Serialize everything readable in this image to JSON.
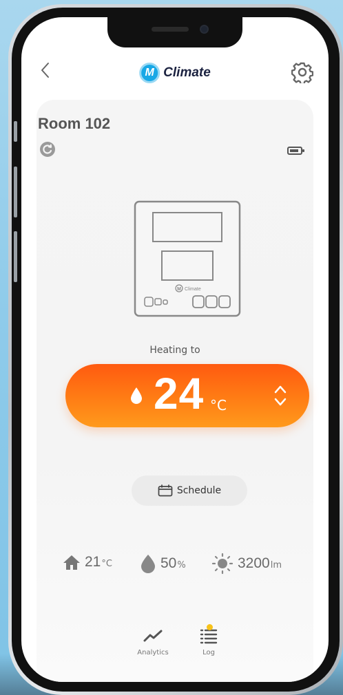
{
  "app": {
    "logo_letter": "M",
    "name": "Climate"
  },
  "room": {
    "title": "Room 102"
  },
  "device_label": "Climate",
  "heating": {
    "label": "Heating to",
    "value": "24",
    "unit": "°C",
    "gradient_colors": [
      "#ff5a10",
      "#ff9a1c"
    ]
  },
  "schedule": {
    "label": "Schedule"
  },
  "stats": [
    {
      "icon": "home-icon",
      "value": "21",
      "unit": "°C"
    },
    {
      "icon": "humidity-drop-icon",
      "value": "50",
      "unit": "%"
    },
    {
      "icon": "sun-icon",
      "value": "3200",
      "unit": "lm"
    }
  ],
  "tabs": [
    {
      "icon": "analytics-icon",
      "label": "Analytics"
    },
    {
      "icon": "log-list-icon",
      "label": "Log",
      "has_notification": true
    }
  ],
  "colors": {
    "accent": "#18a8e6",
    "notification": "#f7c21a"
  }
}
